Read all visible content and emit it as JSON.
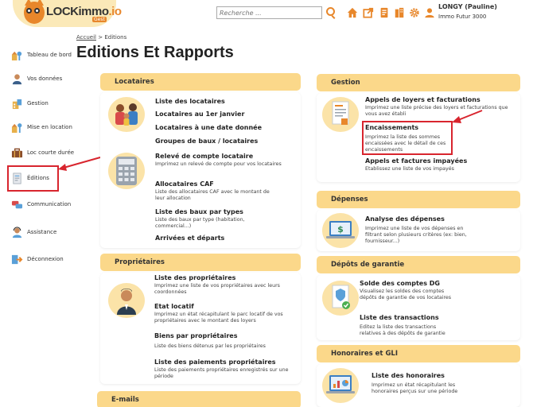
{
  "header": {
    "logo_main": "LOCKimmo",
    "logo_accent": ".io",
    "logo_sub": "Gest",
    "search_placeholder": "Recherche ...",
    "user_name": "LONGY (Pauline)",
    "user_company": "Immo Futur 3000"
  },
  "sidebar": {
    "items": [
      {
        "label": "Tableau de bord",
        "icon": "dashboard-icon"
      },
      {
        "label": "Vos données",
        "icon": "user-icon"
      },
      {
        "label": "Gestion",
        "icon": "management-icon"
      },
      {
        "label": "Mise en location",
        "icon": "rental-icon"
      },
      {
        "label": "Loc courte durée",
        "icon": "suitcase-icon"
      },
      {
        "label": "Éditions",
        "icon": "document-icon"
      },
      {
        "label": "Communication",
        "icon": "chat-icon"
      },
      {
        "label": "Assistance",
        "icon": "support-icon"
      },
      {
        "label": "Déconnexion",
        "icon": "logout-icon"
      }
    ]
  },
  "breadcrumb": {
    "home": "Accueil",
    "separator": ">",
    "current": "Editions"
  },
  "page_title": "Editions Et Rapports",
  "left": {
    "locataires": {
      "title": "Locataires",
      "items": [
        {
          "title": "Liste des locataires",
          "desc": ""
        },
        {
          "title": "Locataires au 1er janvier",
          "desc": ""
        },
        {
          "title": "Locataires à une date donnée",
          "desc": ""
        },
        {
          "title": "Groupes de baux / locataires",
          "desc": ""
        },
        {
          "title": "Relevé de compte locataire",
          "desc": "Imprimez un relevé de compte pour vos locataires"
        },
        {
          "title": "Allocataires CAF",
          "desc": "Liste des allocataires CAF avec le montant de leur allocation"
        },
        {
          "title": "Liste des baux par types",
          "desc": "Liste des baux par type (habitation, commercial...)"
        },
        {
          "title": "Arrivées et départs",
          "desc": ""
        }
      ]
    },
    "proprietaires": {
      "title": "Propriétaires",
      "items": [
        {
          "title": "Liste des propriétaires",
          "desc": "Imprimez une liste de vos propriétaires avec leurs coordonnées"
        },
        {
          "title": "Etat locatif",
          "desc": "Imprimez un état récapitulant le parc locatif de vos propriétaires avec le montant des loyers"
        },
        {
          "title": "Biens par propriétaires",
          "desc": "Liste des biens détenus par les propriétaires"
        },
        {
          "title": "Liste des paiements propriétaires",
          "desc": "Liste des paiements propriétaires enregistrés sur une période"
        }
      ]
    },
    "emails": {
      "title": "E-mails"
    }
  },
  "right": {
    "gestion": {
      "title": "Gestion",
      "items": [
        {
          "title": "Appels de loyers et facturations",
          "desc": "Imprimez une liste précise des loyers et facturations que vous avez établi"
        },
        {
          "title": "Encaissements",
          "desc": "Imprimez la liste des sommes encaissées avec le détail de ces encaissements"
        },
        {
          "title": "Appels et factures impayées",
          "desc": "Etablissez une liste de vos impayés"
        }
      ]
    },
    "depenses": {
      "title": "Dépenses",
      "items": [
        {
          "title": "Analyse des dépenses",
          "desc": "Imprimez une liste de vos dépenses en filtrant selon plusieurs critères (ex: bien, fournisseur...)"
        }
      ]
    },
    "depots": {
      "title": "Dépôts de garantie",
      "items": [
        {
          "title": "Solde des comptes DG",
          "desc": "Visualisez les soldes des comptes dépôts de garantie de vos locataires"
        },
        {
          "title": "Liste des transactions",
          "desc": "Editez la liste des transactions relatives à des dépôts de garantie"
        }
      ]
    },
    "honoraires": {
      "title": "Honoraires et GLI",
      "items": [
        {
          "title": "Liste des honoraires",
          "desc": "Imprimez un état récapitulant les honoraires perçus sur une période"
        }
      ]
    }
  },
  "colors": {
    "accent": "#e8872b",
    "panel_header": "#fbd88a",
    "highlight": "#d8252e"
  }
}
